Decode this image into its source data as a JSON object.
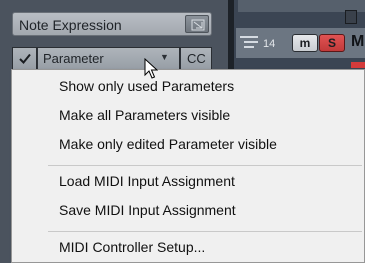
{
  "inspector": {
    "section_title": "Note Expression",
    "header_button_icon": "collapse-icon",
    "columns": {
      "check_icon": "checkmark-icon",
      "parameter_label": "Parameter",
      "parameter_dropdown_icon": "dropdown-arrow-icon",
      "cc_label": "CC"
    }
  },
  "track": {
    "number": "14",
    "mute_label": "m",
    "solo_label": "S",
    "name_initial": "M",
    "colors": {
      "solo": "#c94444",
      "marker": "#d43b3b"
    }
  },
  "context_menu": {
    "items": [
      {
        "label": "Show only used Parameters"
      },
      {
        "label": "Make all Parameters visible"
      },
      {
        "label": "Make only edited Parameter visible"
      },
      {
        "label": "Load MIDI Input Assignment"
      },
      {
        "label": "Save MIDI Input Assignment"
      },
      {
        "label": "MIDI Controller Setup..."
      }
    ]
  }
}
